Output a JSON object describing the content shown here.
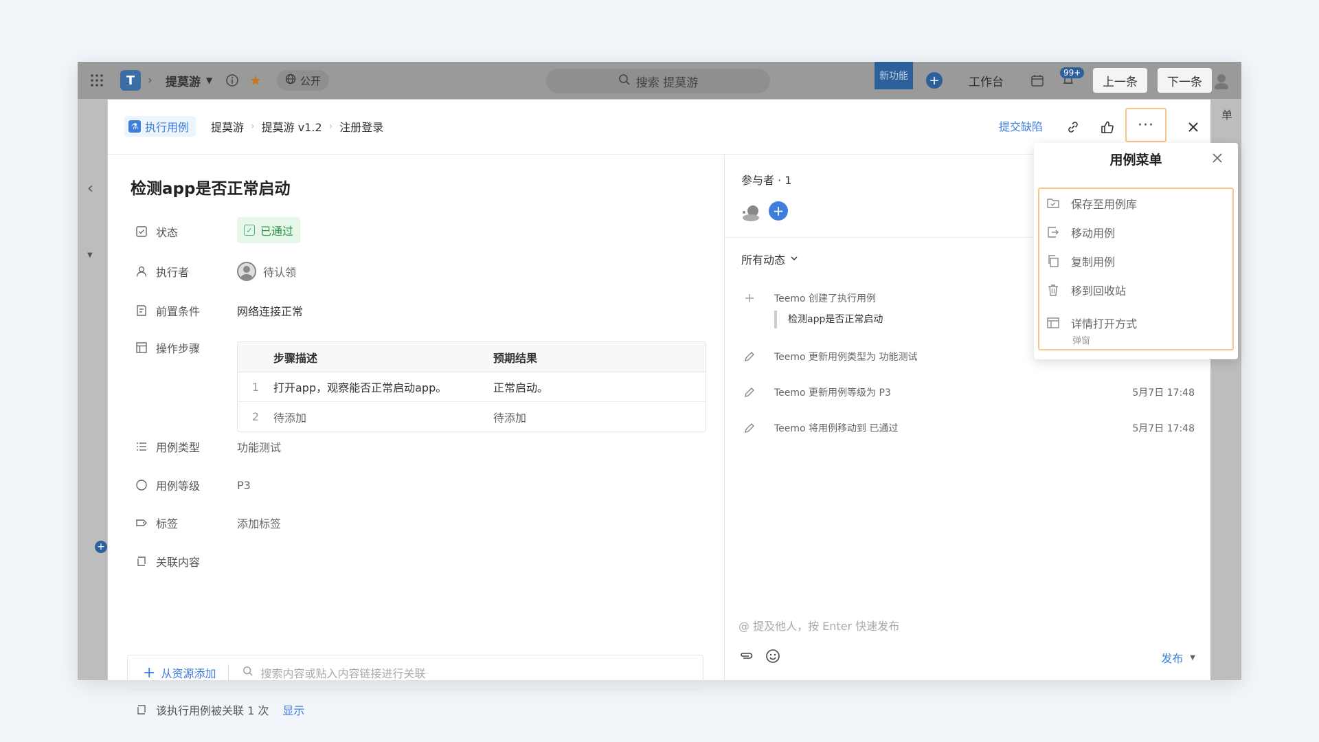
{
  "topbar": {
    "logo_letter": "T",
    "project_name": "提莫游",
    "visibility": "公开",
    "search_placeholder": "搜索 提莫游",
    "new_feature": "新功能",
    "workbench": "工作台",
    "notif_badge": "99+",
    "prev": "上一条",
    "next": "下一条",
    "right_edge_text": "单"
  },
  "modal": {
    "type_label": "执行用例",
    "breadcrumb": [
      "提莫游",
      "提莫游 v1.2",
      "注册登录"
    ],
    "submit_bug": "提交缺陷",
    "more": "···",
    "title": "检测app是否正常启动",
    "fields": {
      "status_label": "状态",
      "status_value": "已通过",
      "executor_label": "执行者",
      "executor_value": "待认领",
      "precondition_label": "前置条件",
      "precondition_value": "网络连接正常",
      "steps_label": "操作步骤",
      "type_label": "用例类型",
      "type_value": "功能测试",
      "level_label": "用例等级",
      "level_value": "P3",
      "tag_label": "标签",
      "tag_value": "添加标签",
      "related_label": "关联内容"
    },
    "steps": {
      "headers": [
        "步骤描述",
        "预期结果"
      ],
      "rows": [
        {
          "num": "1",
          "desc": "打开app，观察能否正常启动app。",
          "expected": "正常启动。"
        },
        {
          "num": "2",
          "desc": "待添加",
          "expected": "待添加"
        }
      ]
    },
    "add_from_resource": "从资源添加",
    "link_search_placeholder": "搜索内容或贴入内容链接进行关联",
    "linked_text": "该执行用例被关联 1 次",
    "linked_show": "显示"
  },
  "right": {
    "participants": "参与者 · 1",
    "activity_filter": "所有动态",
    "activities": [
      {
        "icon": "plus-icon",
        "text": "Teemo 创建了执行用例",
        "quote": "检测app是否正常启动",
        "time": ""
      },
      {
        "icon": "pencil-icon",
        "text": "Teemo 更新用例类型为 功能测试",
        "time": ""
      },
      {
        "icon": "pencil-icon",
        "text": "Teemo 更新用例等级为 P3",
        "time": "5月7日 17:48"
      },
      {
        "icon": "pencil-icon",
        "text": "Teemo 将用例移动到 已通过",
        "time": "5月7日 17:48"
      }
    ],
    "comment_placeholder": "@ 提及他人，按 Enter 快速发布",
    "publish": "发布"
  },
  "case_menu": {
    "title": "用例菜单",
    "items": [
      {
        "icon": "folder-check-icon",
        "label": "保存至用例库"
      },
      {
        "icon": "move-icon",
        "label": "移动用例"
      },
      {
        "icon": "copy-icon",
        "label": "复制用例"
      },
      {
        "icon": "trash-icon",
        "label": "移到回收站"
      },
      {
        "icon": "layout-icon",
        "label": "详情打开方式",
        "sub": "弹窗"
      }
    ]
  },
  "colors": {
    "accent": "#3d7ddc",
    "success_bg": "#e6f6e9",
    "success_text": "#2e9a4a",
    "highlight_border": "#f7c58a"
  }
}
